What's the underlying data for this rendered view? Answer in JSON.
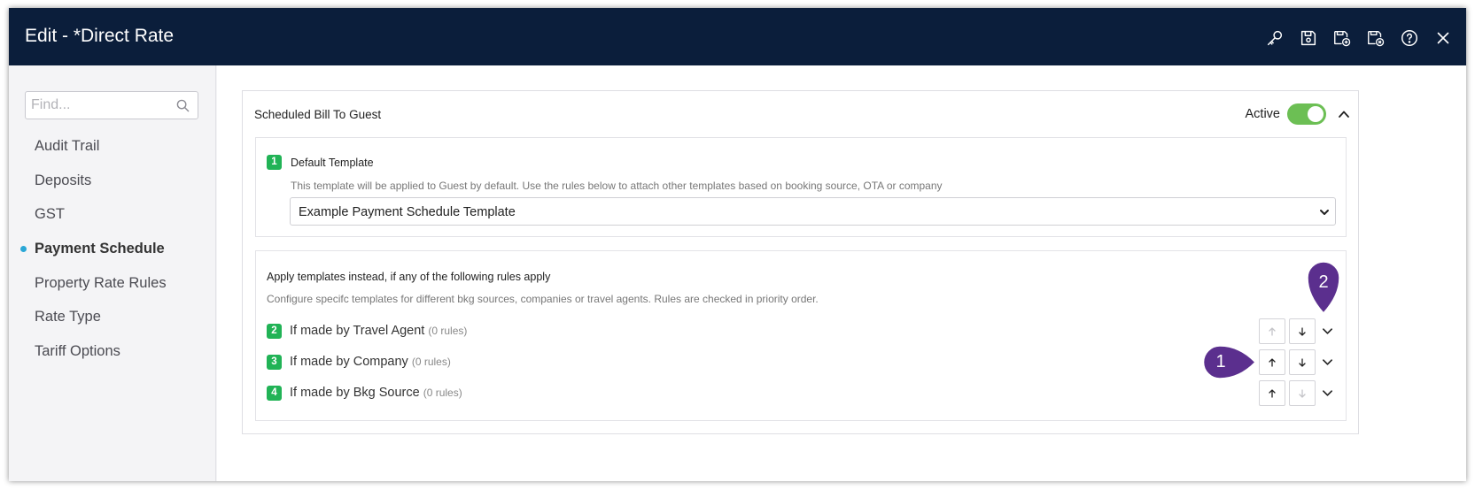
{
  "window": {
    "title": "Edit - *Direct Rate"
  },
  "titlebar_icons": [
    "key-icon",
    "save-icon",
    "save-and-new-icon",
    "save-and-close-icon",
    "help-icon",
    "close-icon"
  ],
  "sidebar": {
    "search_placeholder": "Find...",
    "items": [
      {
        "label": "Audit Trail",
        "active": false
      },
      {
        "label": "Deposits",
        "active": false
      },
      {
        "label": "GST",
        "active": false
      },
      {
        "label": "Payment Schedule",
        "active": true
      },
      {
        "label": "Property Rate Rules",
        "active": false
      },
      {
        "label": "Rate Type",
        "active": false
      },
      {
        "label": "Tariff Options",
        "active": false
      }
    ]
  },
  "card": {
    "title": "Scheduled Bill To Guest",
    "active_label": "Active",
    "active": true
  },
  "default_template": {
    "number": "1",
    "heading": "Default Template",
    "description": "This template will be applied to Guest by default. Use the rules below to attach other templates based on booking source, OTA or company",
    "selected": "Example Payment Schedule Template"
  },
  "rules_section": {
    "heading": "Apply templates instead, if any of the following rules apply",
    "description": "Configure specifc templates for different bkg sources, companies or travel agents. Rules are checked in priority order.",
    "rules": [
      {
        "number": "2",
        "label": "If made by Travel Agent",
        "count": "(0 rules)"
      },
      {
        "number": "3",
        "label": "If made by Company",
        "count": "(0 rules)"
      },
      {
        "number": "4",
        "label": "If made by Bkg Source",
        "count": "(0 rules)"
      }
    ]
  },
  "markers": [
    {
      "label": "1"
    },
    {
      "label": "2"
    }
  ],
  "colors": {
    "titlebar": "#0b1e3b",
    "number_badge": "#21b356",
    "toggle_on": "#6cbf54",
    "marker": "#5b2f8e",
    "active_dot": "#2aa7d6"
  }
}
